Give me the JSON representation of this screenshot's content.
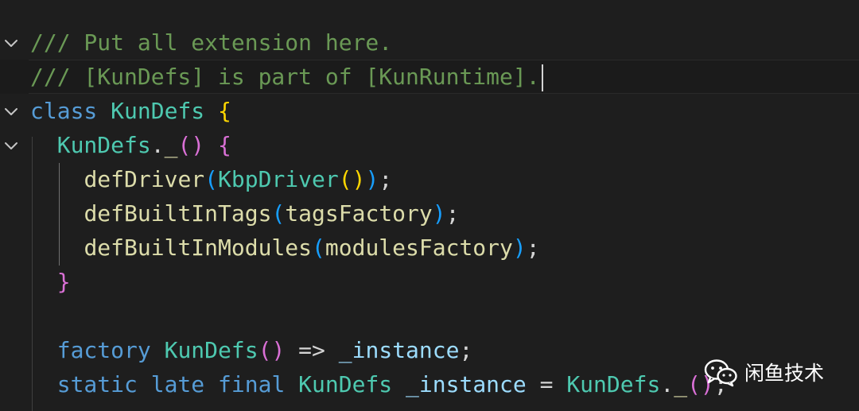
{
  "editor": {
    "lines": [
      {
        "fold": true,
        "tokens": [
          {
            "text": "/// Put all extension here.",
            "cls": "c-comment"
          }
        ]
      },
      {
        "fold": false,
        "current": true,
        "caret": true,
        "tokens": [
          {
            "text": "/// [KunDefs] is part of [KunRuntime].",
            "cls": "c-comment"
          }
        ]
      },
      {
        "fold": true,
        "tokens": [
          {
            "text": "class",
            "cls": "c-keyword"
          },
          {
            "text": " ",
            "cls": "c-plain"
          },
          {
            "text": "KunDefs",
            "cls": "c-class"
          },
          {
            "text": " ",
            "cls": "c-plain"
          },
          {
            "text": "{",
            "cls": "c-b1"
          }
        ]
      },
      {
        "fold": true,
        "tokens": [
          {
            "text": "  ",
            "cls": "c-plain"
          },
          {
            "text": "KunDefs",
            "cls": "c-class"
          },
          {
            "text": ".",
            "cls": "c-plain"
          },
          {
            "text": "_",
            "cls": "c-func"
          },
          {
            "text": "()",
            "cls": "c-b2"
          },
          {
            "text": " ",
            "cls": "c-plain"
          },
          {
            "text": "{",
            "cls": "c-b2"
          }
        ]
      },
      {
        "fold": false,
        "tokens": [
          {
            "text": "    ",
            "cls": "c-plain"
          },
          {
            "text": "defDriver",
            "cls": "c-func"
          },
          {
            "text": "(",
            "cls": "c-b3"
          },
          {
            "text": "KbpDriver",
            "cls": "c-class"
          },
          {
            "text": "()",
            "cls": "c-b1"
          },
          {
            "text": ")",
            "cls": "c-b3"
          },
          {
            "text": ";",
            "cls": "c-plain"
          }
        ]
      },
      {
        "fold": false,
        "tokens": [
          {
            "text": "    ",
            "cls": "c-plain"
          },
          {
            "text": "defBuiltInTags",
            "cls": "c-func"
          },
          {
            "text": "(",
            "cls": "c-b3"
          },
          {
            "text": "tagsFactory",
            "cls": "c-func"
          },
          {
            "text": ")",
            "cls": "c-b3"
          },
          {
            "text": ";",
            "cls": "c-plain"
          }
        ]
      },
      {
        "fold": false,
        "tokens": [
          {
            "text": "    ",
            "cls": "c-plain"
          },
          {
            "text": "defBuiltInModules",
            "cls": "c-func"
          },
          {
            "text": "(",
            "cls": "c-b3"
          },
          {
            "text": "modulesFactory",
            "cls": "c-func"
          },
          {
            "text": ")",
            "cls": "c-b3"
          },
          {
            "text": ";",
            "cls": "c-plain"
          }
        ]
      },
      {
        "fold": false,
        "tokens": [
          {
            "text": "  ",
            "cls": "c-plain"
          },
          {
            "text": "}",
            "cls": "c-b2"
          }
        ]
      },
      {
        "fold": false,
        "tokens": []
      },
      {
        "fold": false,
        "tokens": [
          {
            "text": "  ",
            "cls": "c-plain"
          },
          {
            "text": "factory",
            "cls": "c-keyword"
          },
          {
            "text": " ",
            "cls": "c-plain"
          },
          {
            "text": "KunDefs",
            "cls": "c-class"
          },
          {
            "text": "()",
            "cls": "c-b2"
          },
          {
            "text": " => ",
            "cls": "c-plain"
          },
          {
            "text": "_instance",
            "cls": "c-var"
          },
          {
            "text": ";",
            "cls": "c-plain"
          }
        ]
      },
      {
        "fold": false,
        "tokens": [
          {
            "text": "  ",
            "cls": "c-plain"
          },
          {
            "text": "static late final",
            "cls": "c-keyword"
          },
          {
            "text": " ",
            "cls": "c-plain"
          },
          {
            "text": "KunDefs",
            "cls": "c-class"
          },
          {
            "text": " ",
            "cls": "c-plain"
          },
          {
            "text": "_instance",
            "cls": "c-var"
          },
          {
            "text": " = ",
            "cls": "c-plain"
          },
          {
            "text": "KunDefs",
            "cls": "c-class"
          },
          {
            "text": ".",
            "cls": "c-plain"
          },
          {
            "text": "_",
            "cls": "c-func"
          },
          {
            "text": "()",
            "cls": "c-b2"
          },
          {
            "text": ";",
            "cls": "c-plain"
          }
        ]
      }
    ]
  },
  "watermark": {
    "text": "闲鱼技术",
    "icon": "wechat-icon"
  }
}
